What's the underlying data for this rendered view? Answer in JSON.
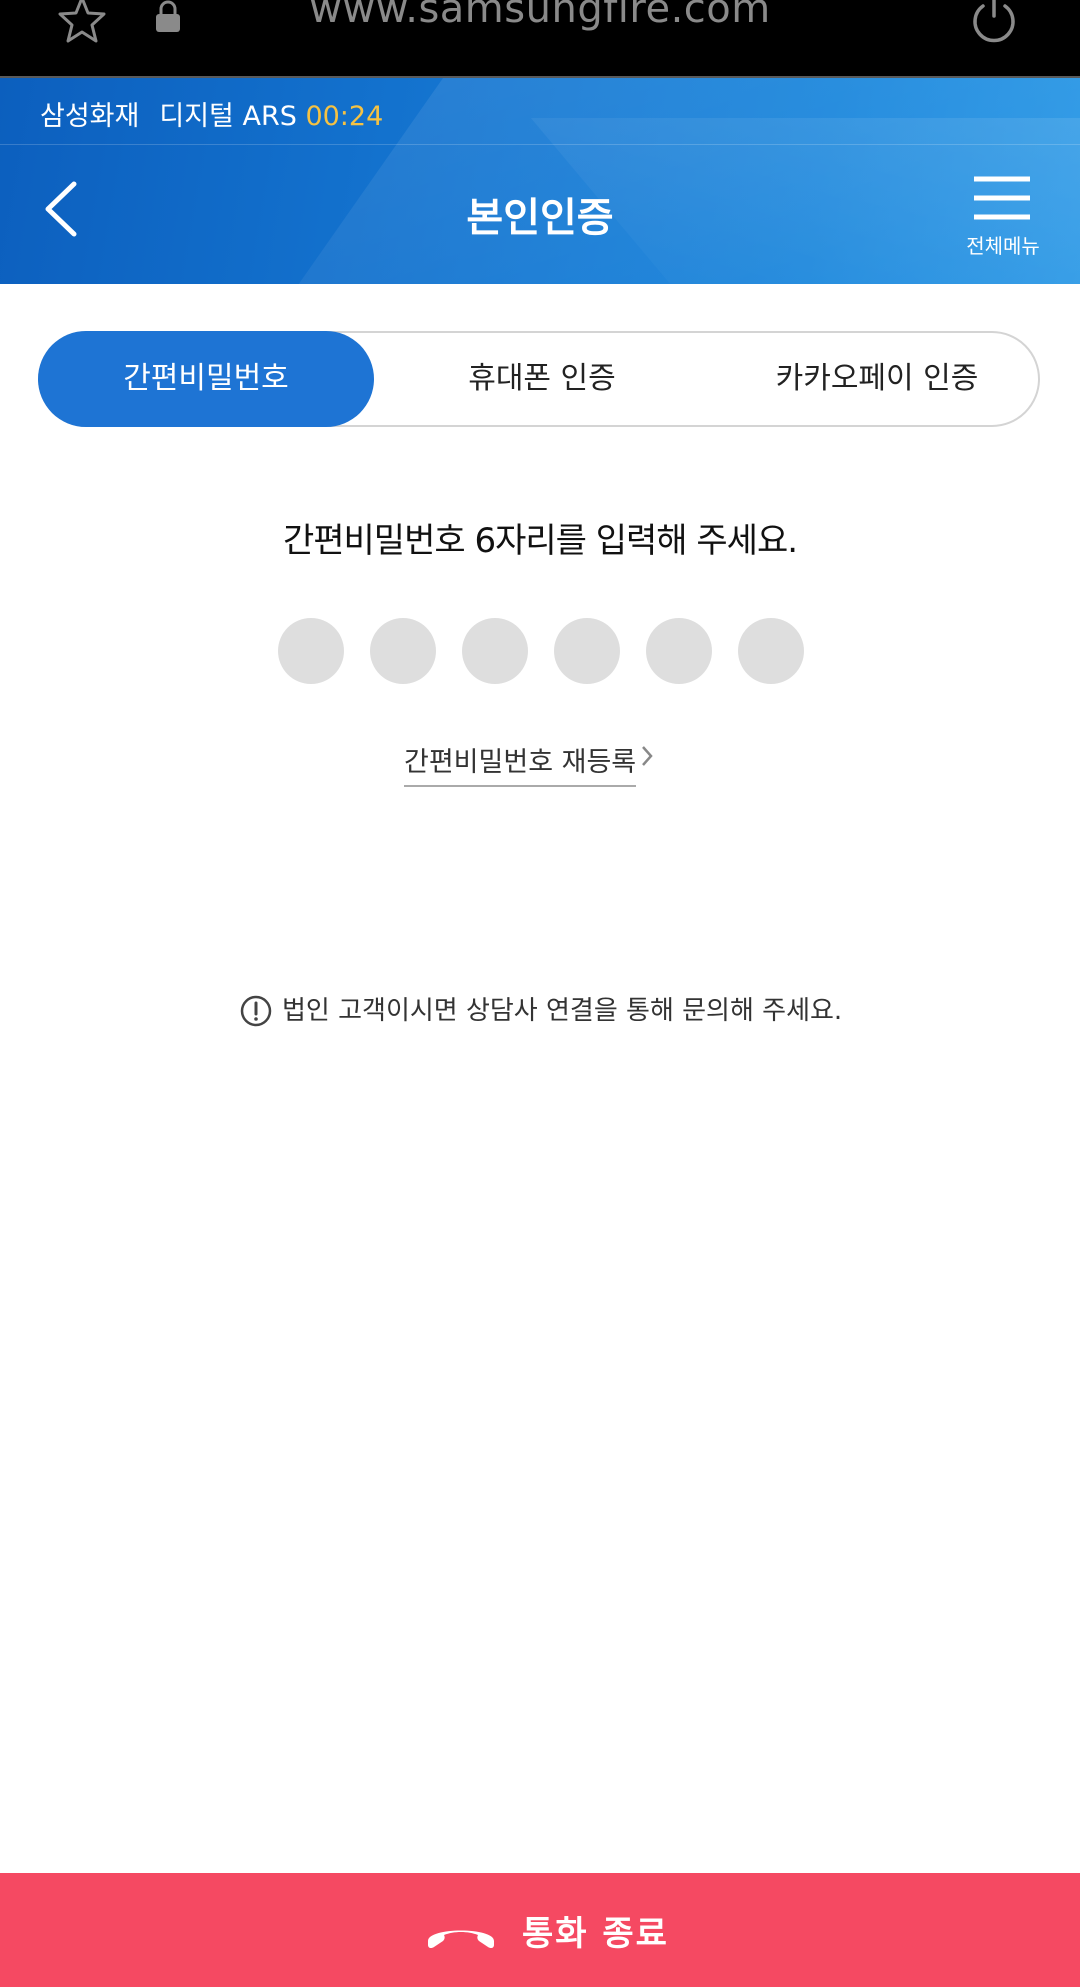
{
  "browser": {
    "url": "www.samsungfire.com"
  },
  "header": {
    "company": "삼성화재",
    "service": "디지털 ARS",
    "timer": "00:24",
    "title": "본인인증",
    "menu_label": "전체메뉴"
  },
  "tabs": [
    {
      "label": "간편비밀번호",
      "active": true
    },
    {
      "label": "휴대폰 인증",
      "active": false
    },
    {
      "label": "카카오페이 인증",
      "active": false
    }
  ],
  "pin": {
    "prompt": "간편비밀번호 6자리를 입력해 주세요.",
    "digits_total": 6,
    "digits_entered": 0
  },
  "reregister_link": "간편비밀번호 재등록",
  "notice": "법인 고객이시면 상담사 연결을 통해 문의해 주세요.",
  "end_call": {
    "label": "통화 종료"
  },
  "colors": {
    "header_blue": "#1577d2",
    "active_tab": "#1e74d4",
    "timer": "#f5c243",
    "end_call": "#f54962",
    "pin_dot": "#dedede"
  }
}
